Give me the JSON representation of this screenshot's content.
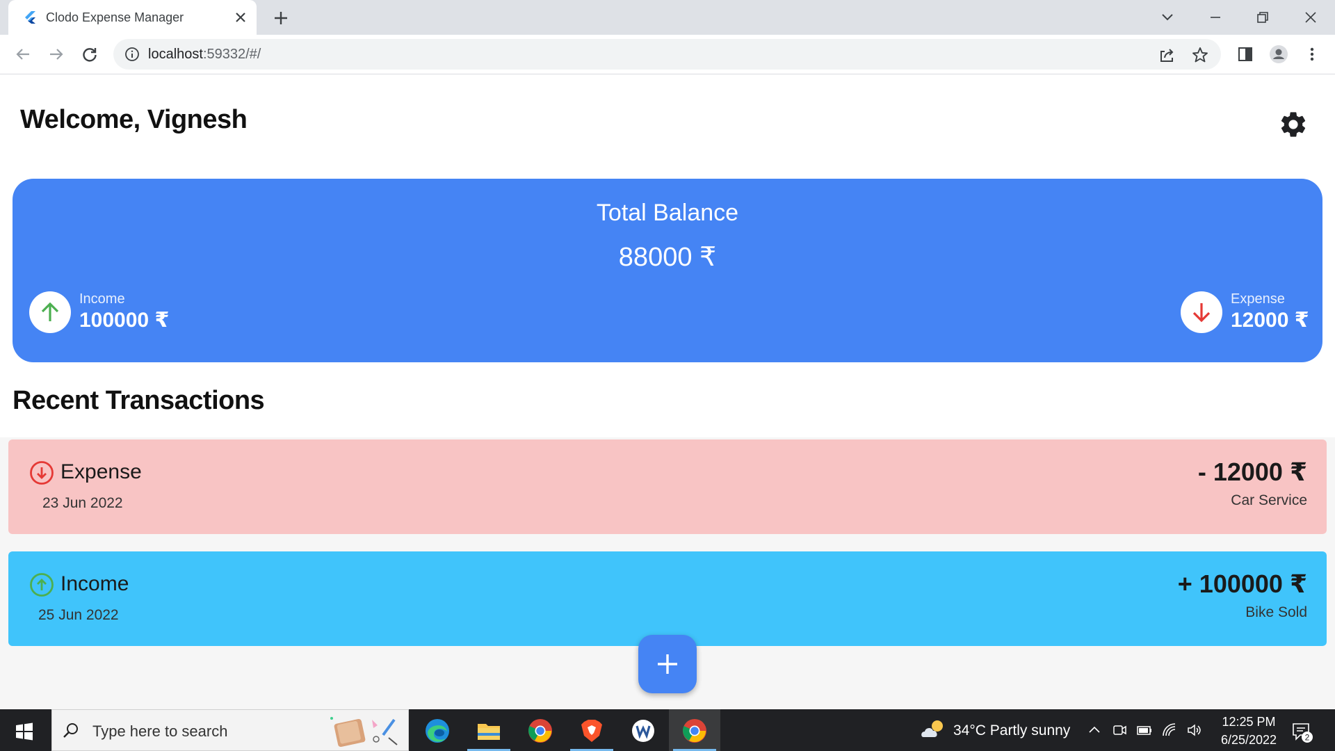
{
  "browser": {
    "tab_title": "Clodo Expense Manager",
    "url_host": "localhost",
    "url_rest": ":59332/#/"
  },
  "app": {
    "welcome": "Welcome, Vignesh",
    "balance": {
      "title": "Total Balance",
      "amount": "88000 ₹",
      "income_label": "Income",
      "income_value": "100000 ₹",
      "expense_label": "Expense",
      "expense_value": "12000 ₹"
    },
    "recent_title": "Recent Transactions",
    "transactions": [
      {
        "type": "Expense",
        "date": "23 Jun 2022",
        "amount": "- 12000 ₹",
        "description": "Car Service",
        "color": "#f8c4c4"
      },
      {
        "type": "Income",
        "date": "25 Jun 2022",
        "amount": "+ 100000 ₹",
        "description": "Bike Sold",
        "color": "#40c4fb"
      }
    ],
    "colors": {
      "primary": "#4584f4",
      "income_green": "#4caf50",
      "expense_red": "#e53935"
    }
  },
  "taskbar": {
    "search_placeholder": "Type here to search",
    "weather": "34°C  Partly sunny",
    "time": "12:25 PM",
    "date": "6/25/2022",
    "notification_count": "2",
    "apps": [
      "edge-icon",
      "file-explorer-icon",
      "chrome-icon",
      "brave-icon",
      "word-icon",
      "chrome-active-icon"
    ]
  }
}
